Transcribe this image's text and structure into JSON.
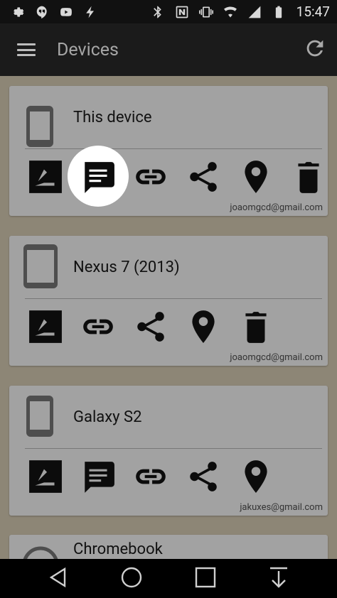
{
  "status": {
    "time": "15:47"
  },
  "appbar": {
    "title": "Devices"
  },
  "devices": [
    {
      "name": "This device",
      "email": "joaomgcd@gmail.com"
    },
    {
      "name": "Nexus 7 (2013)",
      "email": "joaomgcd@gmail.com"
    },
    {
      "name": "Galaxy S2",
      "email": "jakuxes@gmail.com"
    },
    {
      "name": "Chromebook",
      "email": ""
    }
  ]
}
